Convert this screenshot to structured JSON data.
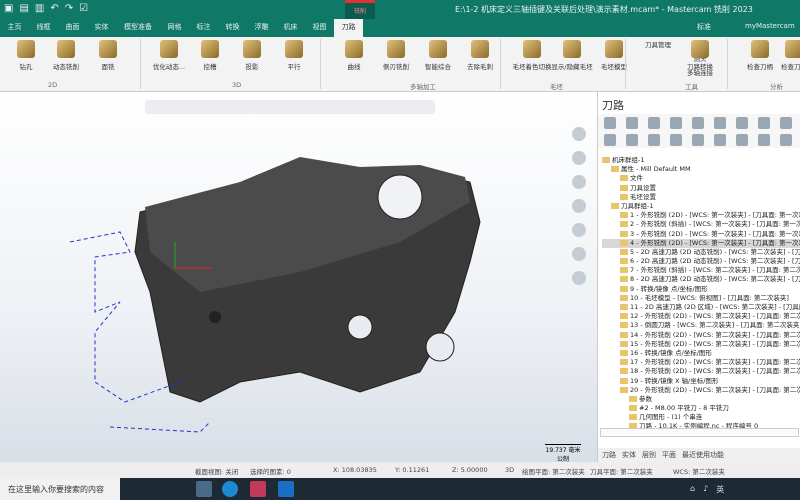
{
  "titlebar": {
    "title": "E:\\1-2 机床定义三轴插键及关联后处理\\演示素材.mcam* - Mastercam 铣削 2023",
    "context_tab": "铣削"
  },
  "tabs": [
    "主页",
    "线框",
    "曲面",
    "实体",
    "模型准备",
    "网格",
    "标注",
    "转换",
    "浮雕",
    "机床",
    "视图",
    "刀路"
  ],
  "active_tab": "刀路",
  "tabs_right": {
    "standard": "标准",
    "user": "myMastercam"
  },
  "ribbon": {
    "buttons_2d": [
      "钻孔",
      "动态铣削",
      "面铣"
    ],
    "buttons_3d": [
      "优化动态...",
      "挖槽",
      "投影",
      "平行"
    ],
    "buttons_multi": [
      "曲线",
      "侧刃铣削",
      "智能综合",
      "去除毛刺"
    ],
    "buttons_stock": [
      "毛坯着色切换",
      "显示/隐藏毛坯",
      "毛坯模型"
    ],
    "buttons_utility": [
      "刀具管理",
      "测头",
      "多轴连接",
      "刀路转换"
    ],
    "buttons_analysis": [
      "检查刀柄",
      "检查刀具"
    ],
    "groups": [
      "2D",
      "3D",
      "多轴加工",
      "毛坯",
      "工具",
      "分析"
    ]
  },
  "viewport": {
    "scale_value": "19.737 毫米",
    "scale_unit": "公制"
  },
  "panel": {
    "title": "刀路",
    "tree": [
      {
        "level": 0,
        "text": "机床群组-1"
      },
      {
        "level": 1,
        "text": "属性 - Mill Default MM"
      },
      {
        "level": 2,
        "text": "文件"
      },
      {
        "level": 2,
        "text": "刀具设置"
      },
      {
        "level": 2,
        "text": "毛坯设置"
      },
      {
        "level": 1,
        "text": "刀具群组-1"
      },
      {
        "level": 2,
        "text": "1 - 外形铣削 (2D) - [WCS: 第一次装夹] - [刀具面: 第一次装夹]"
      },
      {
        "level": 2,
        "text": "2 - 外形铣削 (斜插) - [WCS: 第一次装夹] - [刀具面: 第一次装夹]"
      },
      {
        "level": 2,
        "text": "3 - 外形铣削 (2D) - [WCS: 第一次装夹] - [刀具面: 第一次装夹]"
      },
      {
        "level": 2,
        "text": "4 - 外形铣削 (2D) - [WCS: 第一次装夹] - [刀具面: 第一次装夹]",
        "selected": true
      },
      {
        "level": 2,
        "text": "5 - 2D 高速刀路 (2D 动态铣削) - [WCS: 第二次装夹] - [刀具面"
      },
      {
        "level": 2,
        "text": "6 - 2D 高速刀路 (2D 动态铣削) - [WCS: 第二次装夹] - [刀具面"
      },
      {
        "level": 2,
        "text": "7 - 外形铣削 (斜插) - [WCS: 第二次装夹] - [刀具面: 第二次装夹]"
      },
      {
        "level": 2,
        "text": "8 - 2D 高速刀路 (2D 动态铣削) - [WCS: 第二次装夹] - [刀具面"
      },
      {
        "level": 2,
        "text": "9 - 转换/镜像 点/坐标/图形"
      },
      {
        "level": 2,
        "text": "10 - 毛坯模型 - [WCS: 俯视图] - [刀具面: 第二次装夹]"
      },
      {
        "level": 2,
        "text": "11 - 2D 高速刀路 (2D 区域) - [WCS: 第二次装夹] - [刀具面"
      },
      {
        "level": 2,
        "text": "12 - 外形铣削 (2D) - [WCS: 第二次装夹] - [刀具面: 第二次装夹]"
      },
      {
        "level": 2,
        "text": "13 - 倒圆刀路 - [WCS: 第二次装夹] - [刀具面: 第二次装夹]"
      },
      {
        "level": 2,
        "text": "14 - 外形铣削 (2D) - [WCS: 第二次装夹] - [刀具面: 第二次装夹]"
      },
      {
        "level": 2,
        "text": "15 - 外形铣削 (2D) - [WCS: 第二次装夹] - [刀具面: 第二次装夹]"
      },
      {
        "level": 2,
        "text": "16 - 转换/镜像 点/坐标/图形"
      },
      {
        "level": 2,
        "text": "17 - 外形铣削 (2D) - [WCS: 第二次装夹] - [刀具面: 第二次装夹]"
      },
      {
        "level": 2,
        "text": "18 - 外形铣削 (2D) - [WCS: 第二次装夹] - [刀具面: 第二次装夹]"
      },
      {
        "level": 2,
        "text": "19 - 转换/镜像 X 轴/坐标/图形"
      },
      {
        "level": 2,
        "text": "20 - 外形铣削 (2D) - [WCS: 第二次装夹] - [刀具面: 第二次装夹]"
      },
      {
        "level": 3,
        "text": "参数"
      },
      {
        "level": 3,
        "text": "#2 - M8.00 平铣刀 - 8 平铣刀"
      },
      {
        "level": 3,
        "text": "几何图形 - (1) 个串连"
      },
      {
        "level": 3,
        "text": "刀路 - 10.1K - 实例编程.nc - 程序编号 0"
      }
    ],
    "bottom_tabs": [
      "刀路",
      "实体",
      "层别",
      "平面",
      "最近使用功能"
    ]
  },
  "status": {
    "section_view": "截面视图: 关闭",
    "selected": "选择的图素: 0",
    "x": "X:  108.03835",
    "y": "Y:  0.11261",
    "z": "Z:  5.00000",
    "mode": "3D",
    "cplane": "绘图平面: 第二次装夹",
    "tplane": "刀具平面: 第二次装夹",
    "wcs": "WCS: 第二次装夹"
  },
  "taskbar": {
    "search_placeholder": "在这里输入你要搜索的内容",
    "lang": "英"
  }
}
